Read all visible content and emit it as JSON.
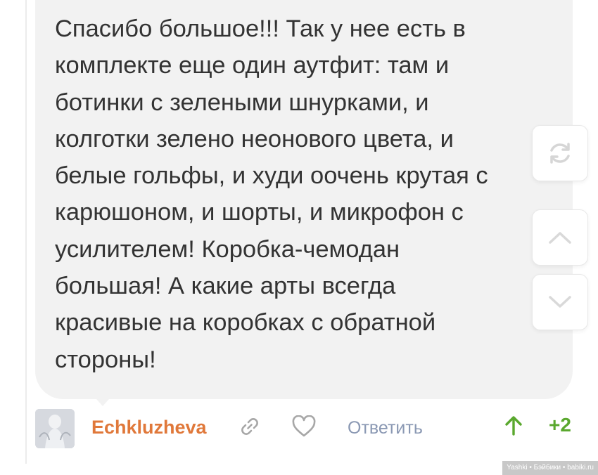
{
  "comment": {
    "text": "Спасибо большое!!! Так у нее есть в\nкомплекте еще один аутфит: там и\nботинки с зелеными шнурками, и\nколготки зелено неонового цвета, и\nбелые гольфы, и худи оочень крутая с\nкарюшоном, и шорты, и микрофон с\nусилителем! Коробка-чемодан\nбольшая! А какие арты всегда\nкрасивые на коробках с обратной\nстороны!"
  },
  "sidebar": {
    "refresh_icon": "refresh-icon",
    "up_icon": "chevron-up-icon",
    "down_icon": "chevron-down-icon"
  },
  "footer": {
    "author": "Echkluzheva",
    "reply_label": "Ответить",
    "score": "+2",
    "author_color": "#e0783a",
    "score_color": "#5aa82e",
    "reply_color": "#8a98b3"
  },
  "watermark": "Yashki • Бэйбики • babiki.ru"
}
